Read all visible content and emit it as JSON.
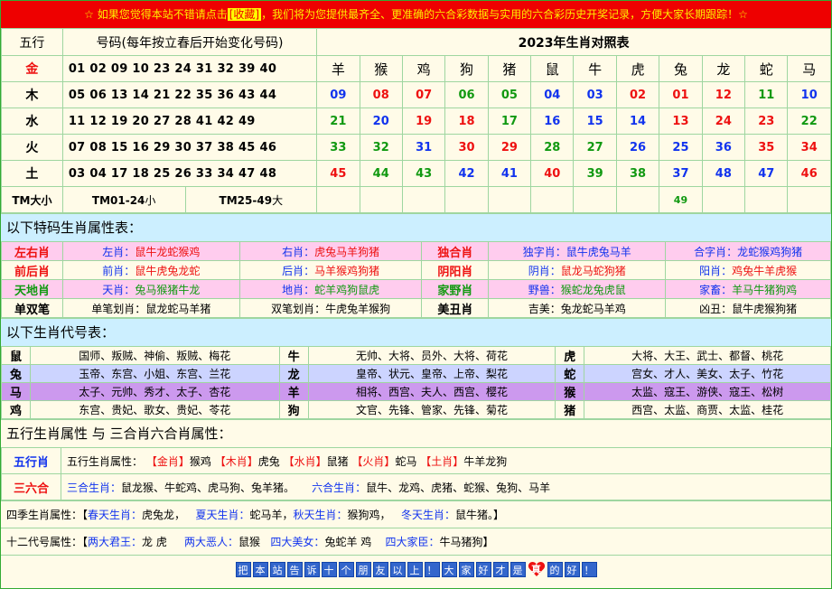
{
  "banner": {
    "prefix": "☆ 如果您觉得本站不错请点击",
    "link": "[收藏]",
    "suffix": "，我们将为您提供最齐全、更准确的六合彩数据与实用的六合彩历史开奖记录，方便大家长期跟踪！☆"
  },
  "main": {
    "col_wuxing": "五行",
    "col_haoma": "号码(每年按立春后开始变化号码)",
    "col_year": "2023年生肖对照表",
    "zodiac_header": [
      "羊",
      "猴",
      "鸡",
      "狗",
      "猪",
      "鼠",
      "牛",
      "虎",
      "兔",
      "龙",
      "蛇",
      "马"
    ],
    "rows": [
      {
        "el": "金",
        "nums": "01 02 09 10 23 24 31 32 39 40"
      },
      {
        "el": "木",
        "nums": "05 06 13 14 21 22 35 36 43 44"
      },
      {
        "el": "水",
        "nums": "11 12 19 20 27 28 41 42 49"
      },
      {
        "el": "火",
        "nums": "07 08 15 16 29 30 37 38 45 46"
      },
      {
        "el": "土",
        "nums": "03 04 17 18 25 26 33 34 47 48"
      }
    ],
    "grid": [
      [
        "09",
        "08",
        "07",
        "06",
        "05",
        "04",
        "03",
        "02",
        "01",
        "12",
        "11",
        "10"
      ],
      [
        "21",
        "20",
        "19",
        "18",
        "17",
        "16",
        "15",
        "14",
        "13",
        "24",
        "23",
        "22"
      ],
      [
        "33",
        "32",
        "31",
        "30",
        "29",
        "28",
        "27",
        "26",
        "25",
        "36",
        "35",
        "34"
      ],
      [
        "45",
        "44",
        "43",
        "42",
        "41",
        "40",
        "39",
        "38",
        "37",
        "48",
        "47",
        "46"
      ]
    ],
    "tm_label": "TM大小",
    "tm_small": "TM01-24",
    "tm_small_suffix": "小",
    "tm_big": "TM25-49",
    "tm_big_suffix": "大",
    "tm_extra": "49"
  },
  "colors": {
    "red": "#ee1111",
    "blue": "#1133ee",
    "green": "#119911",
    "banner": "#ee0000",
    "section": "#ccefff"
  },
  "attr": {
    "title": "以下特码生肖属性表：",
    "rows": [
      {
        "l1": "左右肖",
        "a": "左肖：",
        "av": "鼠牛龙蛇猴鸡",
        "b": "右肖：",
        "bv": "虎兔马羊狗猪",
        "l2": "独合肖",
        "c": "独字肖：",
        "cv": "鼠牛虎兔马羊",
        "d": "合字肖：",
        "dv": "龙蛇猴鸡狗猪"
      },
      {
        "l1": "前后肖",
        "a": "前肖：",
        "av": "鼠牛虎兔龙蛇",
        "b": "后肖：",
        "bv": "马羊猴鸡狗猪",
        "l2": "阴阳肖",
        "c": "阴肖：",
        "cv": "鼠龙马蛇狗猪",
        "d": "阳肖：",
        "dv": "鸡兔牛羊虎猴"
      },
      {
        "l1": "天地肖",
        "a": "天肖：",
        "av": "兔马猴猪牛龙",
        "b": "地肖：",
        "bv": "蛇羊鸡狗鼠虎",
        "l2": "家野肖",
        "c": "野兽：",
        "cv": "猴蛇龙兔虎鼠",
        "d": "家畜：",
        "dv": "羊马牛猪狗鸡"
      },
      {
        "l1": "单双笔",
        "a": "单笔划肖：",
        "av": "鼠龙蛇马羊猪",
        "b": "双笔划肖：",
        "bv": "牛虎兔羊猴狗",
        "l2": "美丑肖",
        "c": "吉美：",
        "cv": "兔龙蛇马羊鸡",
        "d": "凶丑：",
        "dv": "鼠牛虎猴狗猪"
      }
    ]
  },
  "daihao": {
    "title": "以下生肖代号表：",
    "rows": [
      [
        {
          "a": "鼠",
          "t": "国师、叛贼、神偷、叛贼、梅花"
        },
        {
          "a": "牛",
          "t": "无帅、大将、员外、大将、荷花"
        },
        {
          "a": "虎",
          "t": "大将、大王、武士、都督、桃花"
        }
      ],
      [
        {
          "a": "兔",
          "t": "玉帝、东宫、小姐、东宫、兰花"
        },
        {
          "a": "龙",
          "t": "皇帝、状元、皇帝、上帝、梨花"
        },
        {
          "a": "蛇",
          "t": "宫女、才人、美女、太子、竹花"
        }
      ],
      [
        {
          "a": "马",
          "t": "太子、元帅、秀才、太子、杏花"
        },
        {
          "a": "羊",
          "t": "相将、西宫、夫人、西宫、樱花"
        },
        {
          "a": "猴",
          "t": "太监、寇王、游侠、寇王、松树"
        }
      ],
      [
        {
          "a": "鸡",
          "t": "东宫、贵妃、歌女、贵妃、苓花"
        },
        {
          "a": "狗",
          "t": "文官、先锋、管家、先锋、菊花"
        },
        {
          "a": "猪",
          "t": "西宫、太监、商贾、太监、桂花"
        }
      ]
    ]
  },
  "wuxing": {
    "title": "五行生肖属性 与 三合肖六合肖属性：",
    "wx_label": "五行肖",
    "wx_prefix": "五行生肖属性：",
    "wx_items": [
      {
        "k": "【金肖】",
        "v": "猴鸡"
      },
      {
        "k": "【木肖】",
        "v": "虎兔"
      },
      {
        "k": "【水肖】",
        "v": "鼠猪"
      },
      {
        "k": "【火肖】",
        "v": "蛇马"
      },
      {
        "k": "【土肖】",
        "v": "牛羊龙狗"
      }
    ],
    "sl_label": "三六合",
    "sanhe_k": "三合生肖：",
    "sanhe_v": "鼠龙猴、牛蛇鸡、虎马狗、兔羊猪。",
    "liuhe_k": "六合生肖：",
    "liuhe_v": "鼠牛、龙鸡、虎猪、蛇猴、兔狗、马羊"
  },
  "season": {
    "prefix": "四季生肖属性：【",
    "items": [
      {
        "k": "春天生肖：",
        "v": "虎兔龙，"
      },
      {
        "k": "夏天生肖：",
        "v": "蛇马羊，"
      },
      {
        "k": "秋天生肖：",
        "v": "猴狗鸡，"
      },
      {
        "k": "冬天生肖：",
        "v": "鼠牛猪。】"
      }
    ]
  },
  "twelve": {
    "prefix": "十二代号属性：【",
    "items": [
      {
        "k": "两大君王：",
        "v": "龙 虎"
      },
      {
        "k": "两大恶人：",
        "v": "鼠猴"
      },
      {
        "k": "四大美女：",
        "v": "兔蛇羊 鸡"
      },
      {
        "k": "四大家臣：",
        "v": "牛马猪狗】"
      }
    ]
  },
  "footer": {
    "tiles": [
      "把",
      "本",
      "站",
      "告",
      "诉",
      "十",
      "个",
      "朋",
      "友",
      "以",
      "上",
      "！",
      "大",
      "家",
      "好",
      "才",
      "是"
    ],
    "heart_text": "真",
    "tail": [
      "的",
      "好",
      "！"
    ]
  }
}
